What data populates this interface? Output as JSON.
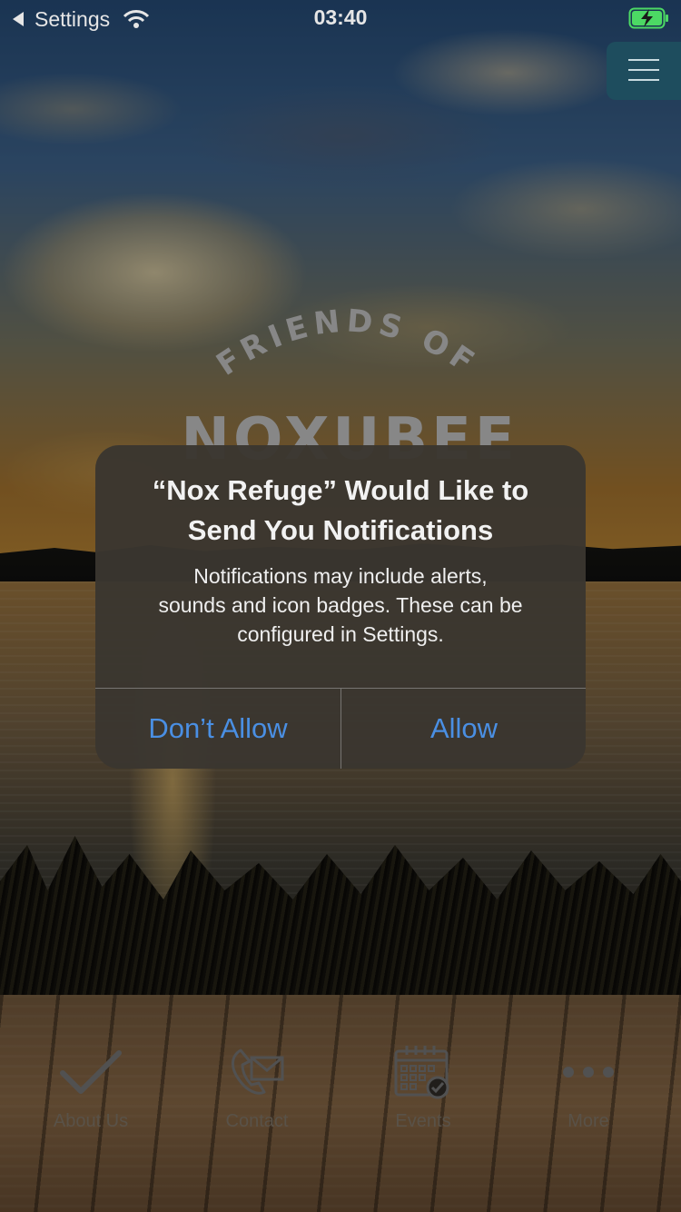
{
  "status_bar": {
    "back_app": "Settings",
    "time": "03:40"
  },
  "logo": {
    "line1": "FRIENDS OF",
    "line2": "NOXUBEE"
  },
  "alert": {
    "title_line1": "“Nox Refuge” Would Like to",
    "title_line2": "Send You Notifications",
    "message_line1": "Notifications may include alerts,",
    "message_line2": "sounds and icon badges. These can be",
    "message_line3": "configured in Settings.",
    "deny_label": "Don’t Allow",
    "allow_label": "Allow"
  },
  "tab_bar": {
    "items": [
      {
        "label": "About Us",
        "icon": "checkmark-icon"
      },
      {
        "label": "Contact",
        "icon": "phone-mail-icon"
      },
      {
        "label": "Events",
        "icon": "calendar-icon"
      },
      {
        "label": "More",
        "icon": "more-dots-icon"
      }
    ]
  },
  "colors": {
    "alert_button": "#4a8fe3",
    "menu_button": "#1e4d5e",
    "battery_charging": "#4cd964"
  }
}
